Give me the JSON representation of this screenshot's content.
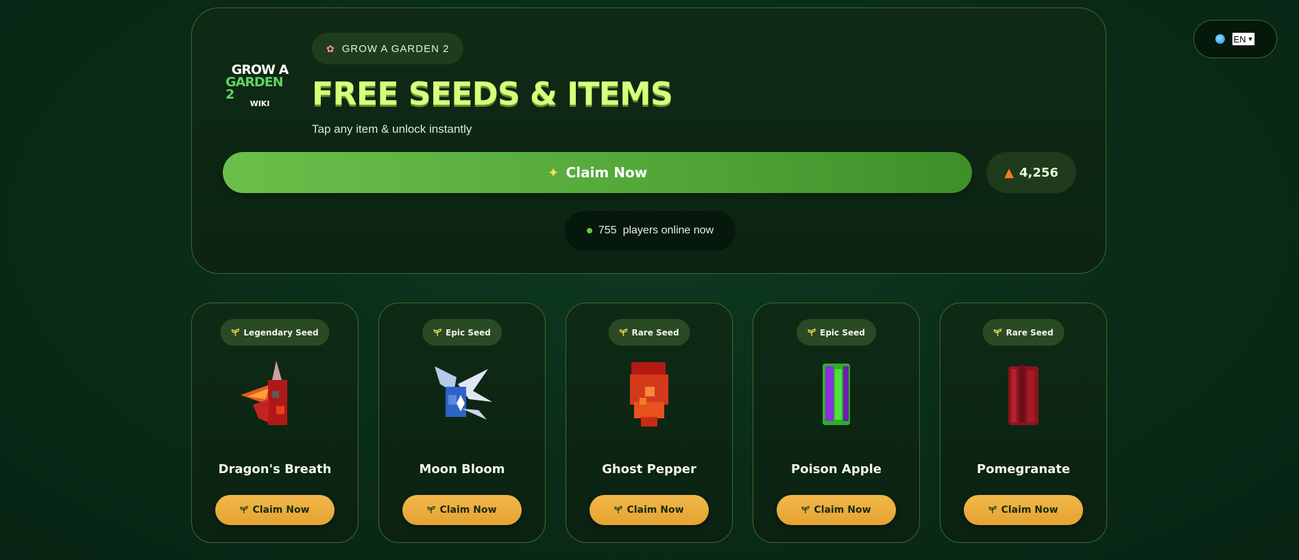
{
  "language": {
    "selected": "EN",
    "icon": "globe-icon"
  },
  "hero": {
    "logo": {
      "line1": "GROW A",
      "line2": "GARDEN 2",
      "line3": "WIKI"
    },
    "tag": "GROW A GARDEN 2",
    "title": "FREE SEEDS & ITEMS",
    "subtitle": "Tap any item & unlock instantly",
    "claim_label": "Claim Now",
    "counter": "4,256",
    "online_count": "755",
    "online_text": "players online now"
  },
  "cards": [
    {
      "rarity": "Legendary Seed",
      "name": "Dragon's Breath",
      "button": "Claim Now"
    },
    {
      "rarity": "Epic Seed",
      "name": "Moon Bloom",
      "button": "Claim Now"
    },
    {
      "rarity": "Rare Seed",
      "name": "Ghost Pepper",
      "button": "Claim Now"
    },
    {
      "rarity": "Epic Seed",
      "name": "Poison Apple",
      "button": "Claim Now"
    },
    {
      "rarity": "Rare Seed",
      "name": "Pomegranate",
      "button": "Claim Now"
    }
  ],
  "colors": {
    "accent_green": "#5fb843",
    "title_lime": "#d6ff7a",
    "button_gold": "#eeb042",
    "border": "#3f6b2d"
  }
}
